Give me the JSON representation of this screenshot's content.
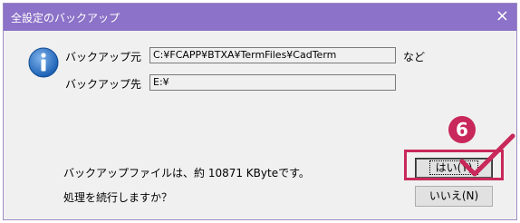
{
  "window": {
    "title": "全設定のバックアップ",
    "close_glyph": "×"
  },
  "form": {
    "src_label": "バックアップ元",
    "src_value": "C:¥FCAPP¥BTXA¥TermFiles¥CadTerm",
    "src_suffix": "など",
    "dst_label": "バックアップ先",
    "dst_value": "E:¥"
  },
  "message": {
    "line1": "バックアップファイルは、約 10871 KByteです。",
    "line2": "処理を続行しますか？"
  },
  "buttons": {
    "yes": "はい(Y)",
    "no": "いいえ(N)"
  },
  "annotation": {
    "step": "6",
    "color": "#c8285a"
  },
  "colors": {
    "titlebar": "#8c72c8",
    "icon": "#1a5fb4"
  }
}
